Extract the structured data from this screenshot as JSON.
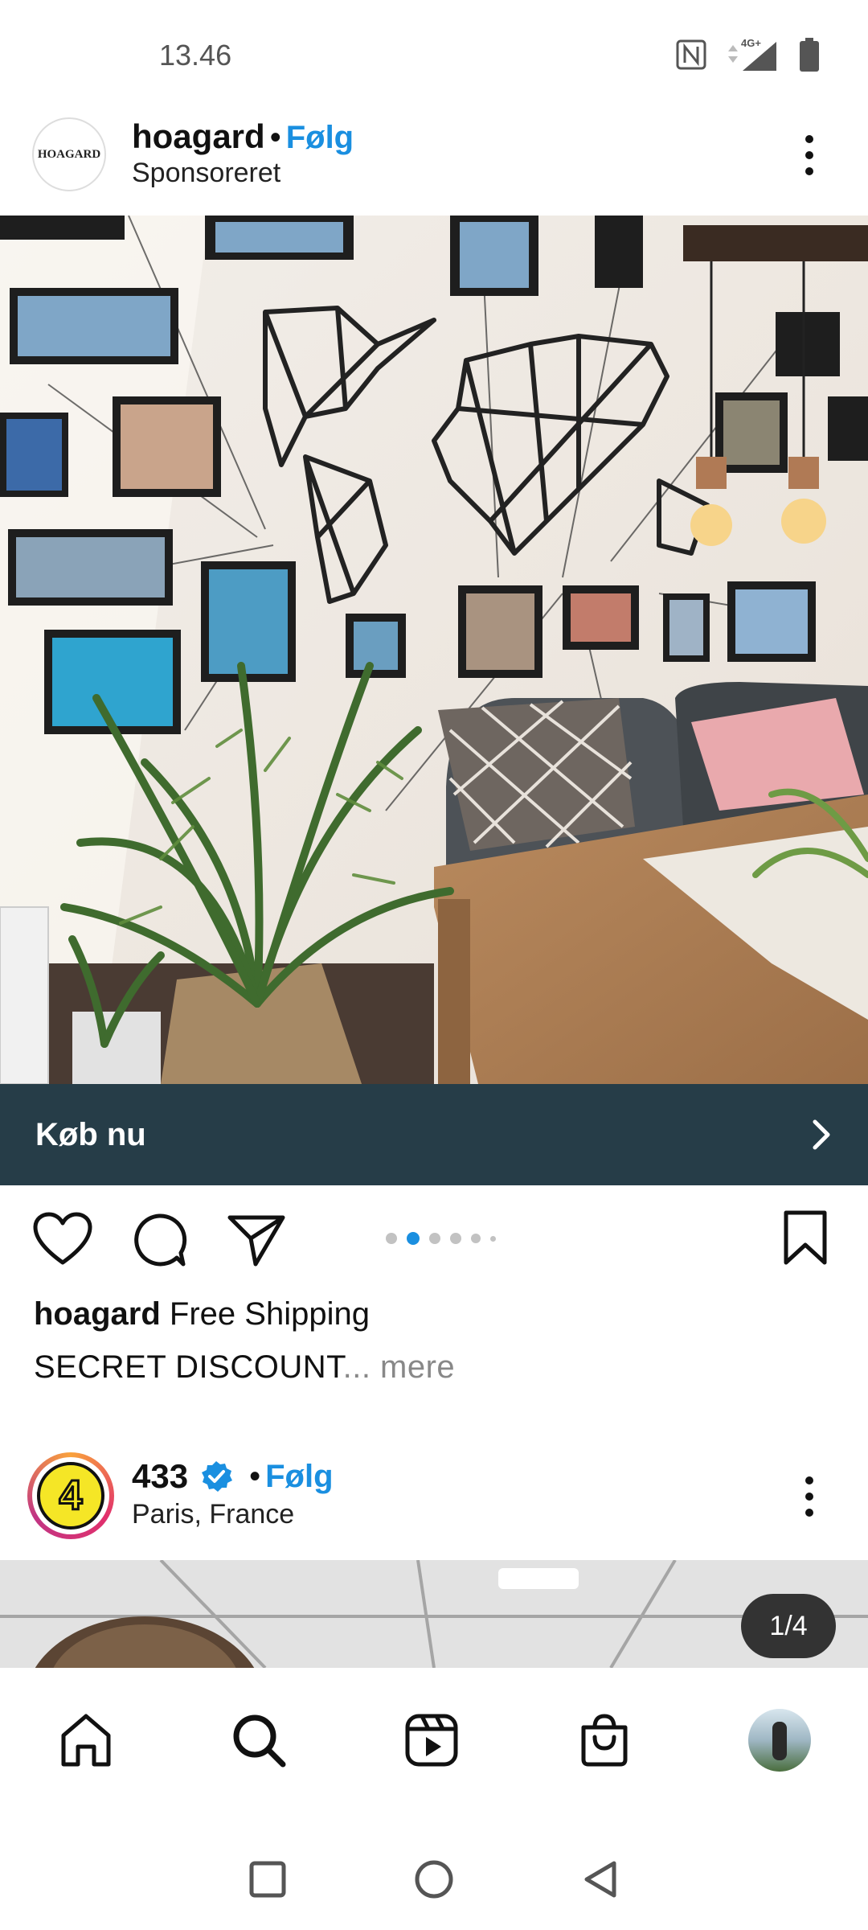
{
  "status": {
    "time": "13.46",
    "network": "4G+"
  },
  "post1": {
    "account": "hoagard",
    "avatar_text": "HOAGARD",
    "separator": "•",
    "follow": "Følg",
    "subtitle": "Sponsoreret",
    "cta": "Køb nu",
    "carousel": {
      "count": 6,
      "active": 2
    },
    "caption_user": "hoagard",
    "caption_text": "Free Shipping",
    "caption_line2": "SECRET DISCOUNT",
    "more": "... mere"
  },
  "post2": {
    "account": "433",
    "avatar_text": "4",
    "separator": "•",
    "follow": "Følg",
    "location": "Paris, France",
    "counter": "1/4"
  },
  "bottom_nav": [
    "home-icon",
    "search-icon",
    "reels-icon",
    "shop-icon",
    "profile-avatar"
  ],
  "system_nav": [
    "recents-button",
    "home-button",
    "back-button"
  ],
  "colors": {
    "follow": "#1a8fe0",
    "cta_bg": "#263d48",
    "dot_active": "#1a8fe0",
    "dot_inactive": "#c2c2c2"
  }
}
